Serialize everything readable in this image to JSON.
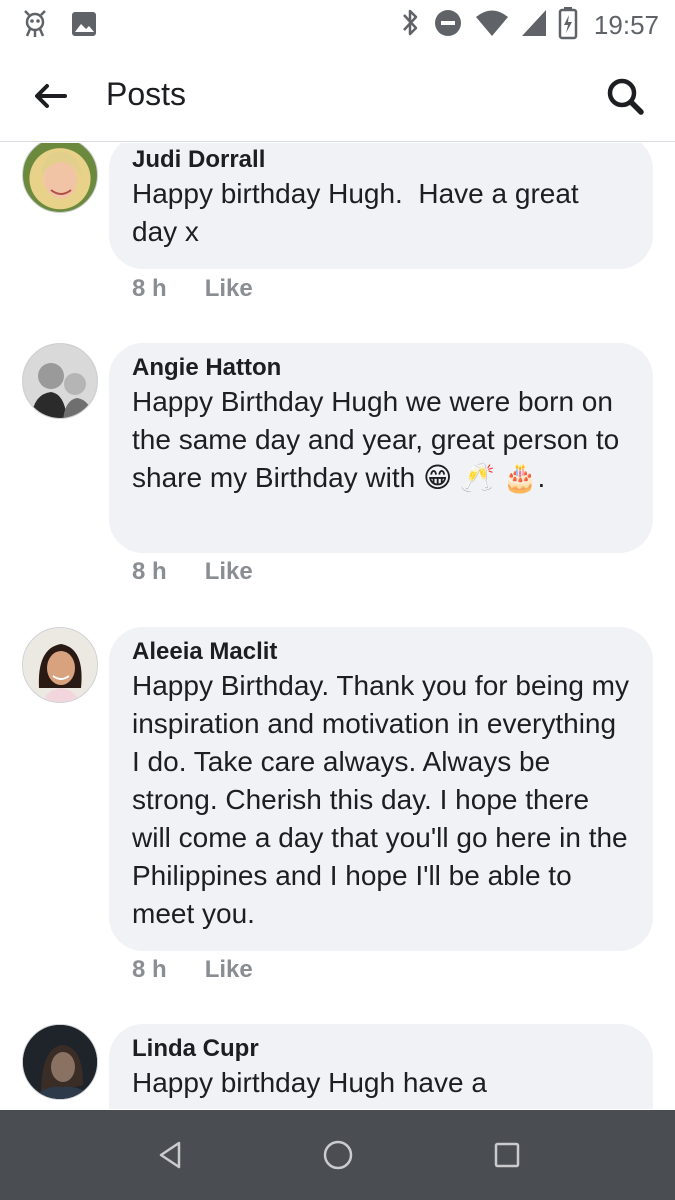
{
  "status_bar": {
    "time": "19:57",
    "left_icons": [
      "notification-app-icon",
      "image-icon"
    ],
    "right_icons": [
      "bluetooth-icon",
      "do-not-disturb-icon",
      "wifi-icon",
      "signal-icon",
      "battery-icon"
    ]
  },
  "header": {
    "title": "Posts"
  },
  "comments": [
    {
      "author": "Judi Dorrall",
      "text": "Happy birthday Hugh.  Have a great day x",
      "time": "8 h",
      "like_label": "Like"
    },
    {
      "author": "Angie Hatton",
      "text": "Happy Birthday Hugh we were born on the same day and year, great person to share my Birthday with",
      "emojis": "😁 🥂 🎂",
      "emoji_suffix": ".",
      "time": "8 h",
      "like_label": "Like"
    },
    {
      "author": "Aleeia Maclit",
      "text": "Happy Birthday. Thank you for being my inspiration and motivation in everything I do. Take care always. Always be strong. Cherish this day. I hope there will come a day that you'll go here in the Philippines and I hope I'll be able to meet you.",
      "time": "8 h",
      "like_label": "Like"
    },
    {
      "author": "Linda Cupr",
      "text": "Happy birthday Hugh have a"
    }
  ],
  "colors": {
    "bubble": "#f0f2f5",
    "meta_text": "#8a8d91",
    "nav_bar": "#4a4d51"
  }
}
